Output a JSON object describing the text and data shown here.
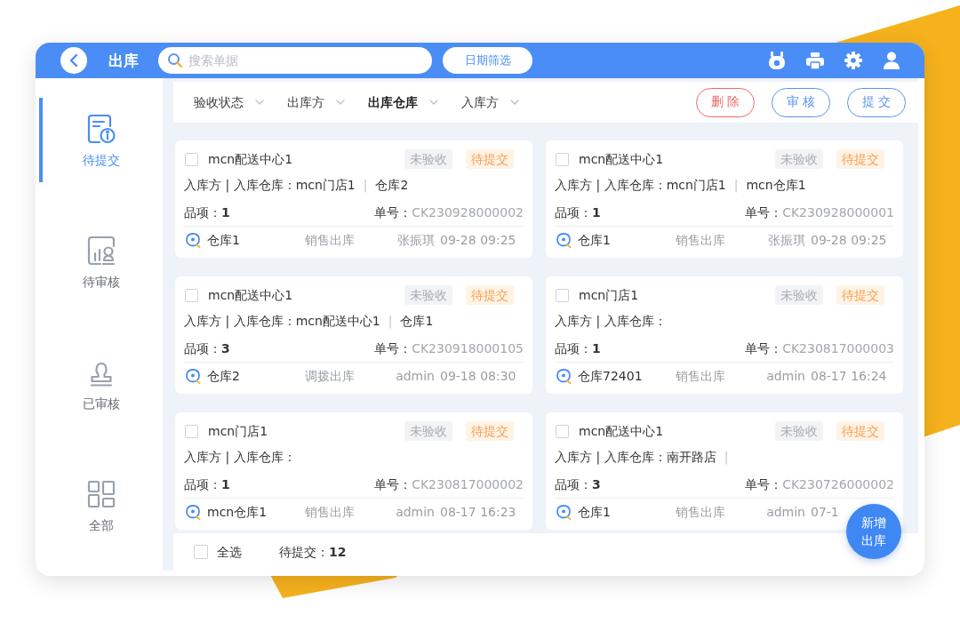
{
  "header": {
    "title": "出库",
    "search": {
      "placeholder": "搜索单据"
    },
    "date_filter": "日期筛选"
  },
  "sidebar": {
    "items": [
      {
        "label": "待提交",
        "kind": "submit",
        "selected": true
      },
      {
        "label": "待审核",
        "kind": "review",
        "selected": false
      },
      {
        "label": "已审核",
        "kind": "approved",
        "selected": false
      },
      {
        "label": "全部",
        "kind": "all",
        "selected": false
      }
    ]
  },
  "filters": [
    {
      "label": "验收状态",
      "selected": false
    },
    {
      "label": "出库方",
      "selected": false
    },
    {
      "label": "出库仓库",
      "selected": true
    },
    {
      "label": "入库方",
      "selected": false
    }
  ],
  "actions": [
    {
      "label": "删除",
      "kind": "danger"
    },
    {
      "label": "审核",
      "kind": "primary"
    },
    {
      "label": "提交",
      "kind": "primary"
    }
  ],
  "orders": [
    {
      "checked": false,
      "name": "mcn配送中心1",
      "tags": [
        {
          "label": "未验收",
          "kind": "neutral"
        },
        {
          "label": "待提交",
          "kind": "warning"
        }
      ],
      "route_label": "入库方 | 入库仓库：",
      "receiver": "mcn门店1",
      "divider": "|",
      "receiver_warehouse": "仓库2",
      "items": "品项：**1**",
      "number_label": "单号：",
      "number": "CK230928000002",
      "warehouse": "仓库1",
      "type": "销售出库",
      "operator": "张振琪",
      "time": "09-28 09:25"
    },
    {
      "checked": false,
      "name": "mcn配送中心1",
      "tags": [
        {
          "label": "未验收",
          "kind": "neutral"
        },
        {
          "label": "待提交",
          "kind": "warning"
        }
      ],
      "route_label": "入库方 | 入库仓库：",
      "receiver": "mcn门店1",
      "divider": "|",
      "receiver_warehouse": "mcn仓库1",
      "items": "品项：**1**",
      "number_label": "单号：",
      "number": "CK230928000001",
      "warehouse": "仓库1",
      "type": "销售出库",
      "operator": "张振琪",
      "time": "09-28 09:25"
    },
    {
      "checked": false,
      "name": "mcn配送中心1",
      "tags": [
        {
          "label": "未验收",
          "kind": "neutral"
        },
        {
          "label": "待提交",
          "kind": "warning"
        }
      ],
      "route_label": "入库方 | 入库仓库：",
      "receiver": "mcn配送中心1",
      "divider": "|",
      "receiver_warehouse": "仓库1",
      "items": "品项：**3**",
      "number_label": "单号：",
      "number": "CK230918000105",
      "warehouse": "仓库2",
      "type": "调拨出库",
      "operator": "admin",
      "time": "09-18 08:30"
    },
    {
      "checked": false,
      "name": "mcn门店1",
      "tags": [
        {
          "label": "未验收",
          "kind": "neutral"
        },
        {
          "label": "待提交",
          "kind": "warning"
        }
      ],
      "route_label": "入库方 | 入库仓库：",
      "items": "品项：**1**",
      "number_label": "单号：",
      "number": "CK230817000003",
      "warehouse": "仓库72401",
      "type": "销售出库",
      "operator": "admin",
      "time": "08-17 16:24"
    },
    {
      "checked": false,
      "name": "mcn门店1",
      "tags": [
        {
          "label": "未验收",
          "kind": "neutral"
        },
        {
          "label": "待提交",
          "kind": "warning"
        }
      ],
      "route_label": "入库方 | 入库仓库：",
      "items": "品项：**1**",
      "number_label": "单号：",
      "number": "CK230817000002",
      "warehouse": "mcn仓库1",
      "type": "销售出库",
      "operator": "admin",
      "time": "08-17 16:23"
    },
    {
      "checked": false,
      "name": "mcn配送中心1",
      "tags": [
        {
          "label": "未验收",
          "kind": "neutral"
        },
        {
          "label": "待提交",
          "kind": "warning"
        }
      ],
      "route_label": "入库方 | 入库仓库：",
      "receiver": "南开路店",
      "divider": "|",
      "items": "品项：**3**",
      "number_label": "单号：",
      "number": "CK230726000002",
      "warehouse": "仓库1",
      "type": "销售出库",
      "operator": "admin",
      "time": "07-1"
    }
  ],
  "footer": {
    "select_all": {
      "label": "全选",
      "checked": false
    },
    "count": "待提交：**12**"
  },
  "fab": {
    "label": "新增出库"
  }
}
